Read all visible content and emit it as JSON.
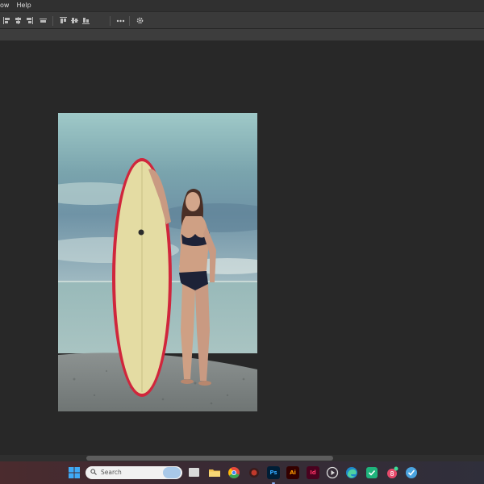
{
  "menubar": {
    "items": [
      "ow",
      "Help"
    ]
  },
  "optionsbar": {
    "tools": [
      {
        "name": "align-left-edges-icon"
      },
      {
        "name": "align-horizontal-centers-icon"
      },
      {
        "name": "align-right-edges-icon"
      },
      {
        "name": "distribute-horizontal-icon"
      },
      {
        "name": "align-top-edges-icon"
      },
      {
        "name": "align-vertical-centers-icon"
      },
      {
        "name": "align-bottom-edges-icon"
      },
      {
        "name": "more-options-icon"
      },
      {
        "name": "settings-gear-icon"
      }
    ]
  },
  "canvas": {
    "image": "photo of woman in black bikini holding cream surfboard with red rail on pebble beach by the sea"
  },
  "taskbar": {
    "search_placeholder": "Search",
    "apps": [
      {
        "name": "start-icon",
        "color": "#3a9bdc"
      },
      {
        "name": "task-view-icon",
        "color": "#bdbdbd"
      },
      {
        "name": "file-explorer-icon",
        "color": "#f2c24e"
      },
      {
        "name": "chrome-icon",
        "color": "#e64a3b"
      },
      {
        "name": "app-red-icon",
        "color": "#c0392b"
      },
      {
        "name": "photoshop-icon",
        "color": "#31a8ff",
        "label": "Ps"
      },
      {
        "name": "illustrator-icon",
        "color": "#ff9a00",
        "label": "Ai"
      },
      {
        "name": "indesign-icon",
        "color": "#ff3366",
        "label": "Id"
      },
      {
        "name": "media-player-icon",
        "color": "#ffffff"
      },
      {
        "name": "edge-icon",
        "color": "#2bb3a3"
      },
      {
        "name": "shield-app-icon",
        "color": "#3ddc97"
      },
      {
        "name": "app-badge-icon",
        "color": "#e64a6b"
      },
      {
        "name": "check-app-icon",
        "color": "#4aa3df"
      }
    ]
  }
}
